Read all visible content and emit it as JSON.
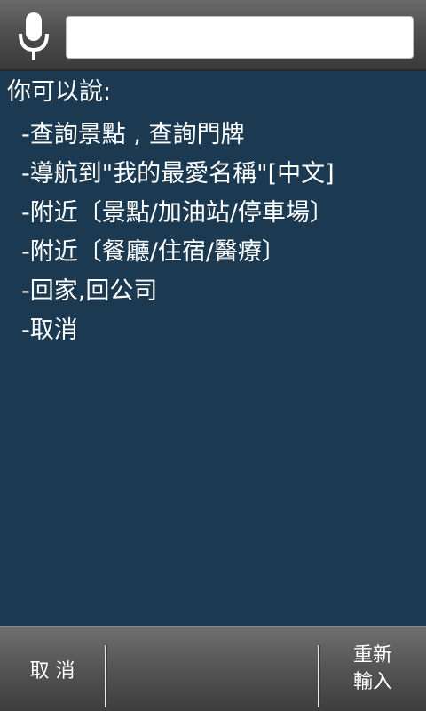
{
  "search": {
    "value": "",
    "mic_icon": "microphone-icon"
  },
  "content": {
    "intro": "你可以說:",
    "hints": [
      "-查詢景點 , 查詢門牌",
      "-導航到\"我的最愛名稱\"[中文]",
      "-附近〔景點/加油站/停車場〕",
      "-附近〔餐廳/住宿/醫療〕",
      "-回家,回公司",
      "-取消"
    ]
  },
  "bottom": {
    "cancel_label": "取 消",
    "retry_label": "重新輸入"
  },
  "colors": {
    "background": "#1b3a52",
    "bar": "#545454",
    "text": "#ffffff"
  }
}
